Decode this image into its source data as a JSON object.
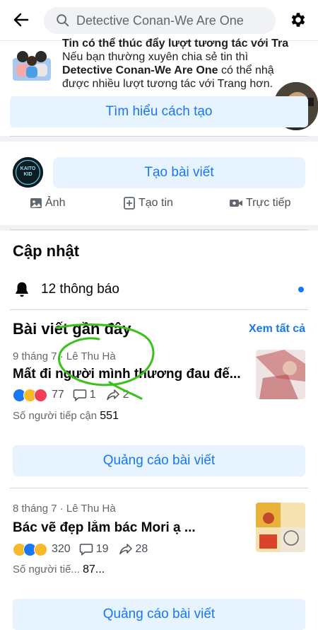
{
  "search": {
    "text": "Detective Conan-We Are One"
  },
  "promo": {
    "title_line": "Tin có thể thúc đẩy lượt tương tác với Tra",
    "body_prefix": "Nếu bạn thường xuyên chia sẻ tin thì ",
    "page_name": "Detective Conan-We Are One",
    "body_suffix": " có thể nhậ được nhiều lượt tương tác với Trang hơn.",
    "button": "Tìm hiểu cách tạo"
  },
  "composer": {
    "avatar_text": "KAITO KID",
    "button": "Tạo bài viết",
    "actions": [
      {
        "label": "Ảnh",
        "icon": "photo-icon"
      },
      {
        "label": "Tạo tin",
        "icon": "add-story-icon"
      },
      {
        "label": "Trực tiếp",
        "icon": "live-video-icon"
      }
    ]
  },
  "updates": {
    "title": "Cập nhật",
    "notifications": "12 thông báo"
  },
  "recent": {
    "title": "Bài viết gần đây",
    "see_all": "Xem tất cả",
    "posts": [
      {
        "meta": "9 tháng 7 · Lê Thu Hà",
        "title": "Mất đi người mình thương đau đế...",
        "reactions": [
          "like",
          "sad",
          "love"
        ],
        "reaction_count": "77",
        "comments": "1",
        "shares": "2",
        "reach_label": "Số người tiếp cận ",
        "reach_value": "551",
        "ad_button": "Quảng cáo bài viết"
      },
      {
        "meta": "8 tháng 7 · Lê Thu Hà",
        "title": "Bác vẽ đẹp lắm bác Mori ạ ...",
        "reactions": [
          "haha",
          "like",
          "sad"
        ],
        "reaction_count": "320",
        "comments": "19",
        "shares": "28",
        "reach_label": "Số người tiế... ",
        "reach_value": "87...",
        "ad_button": "Quảng cáo bài viết"
      }
    ]
  },
  "colors": {
    "accent": "#1877f2",
    "button_bg": "#e7f3ff",
    "annotation": "#39c21a"
  }
}
